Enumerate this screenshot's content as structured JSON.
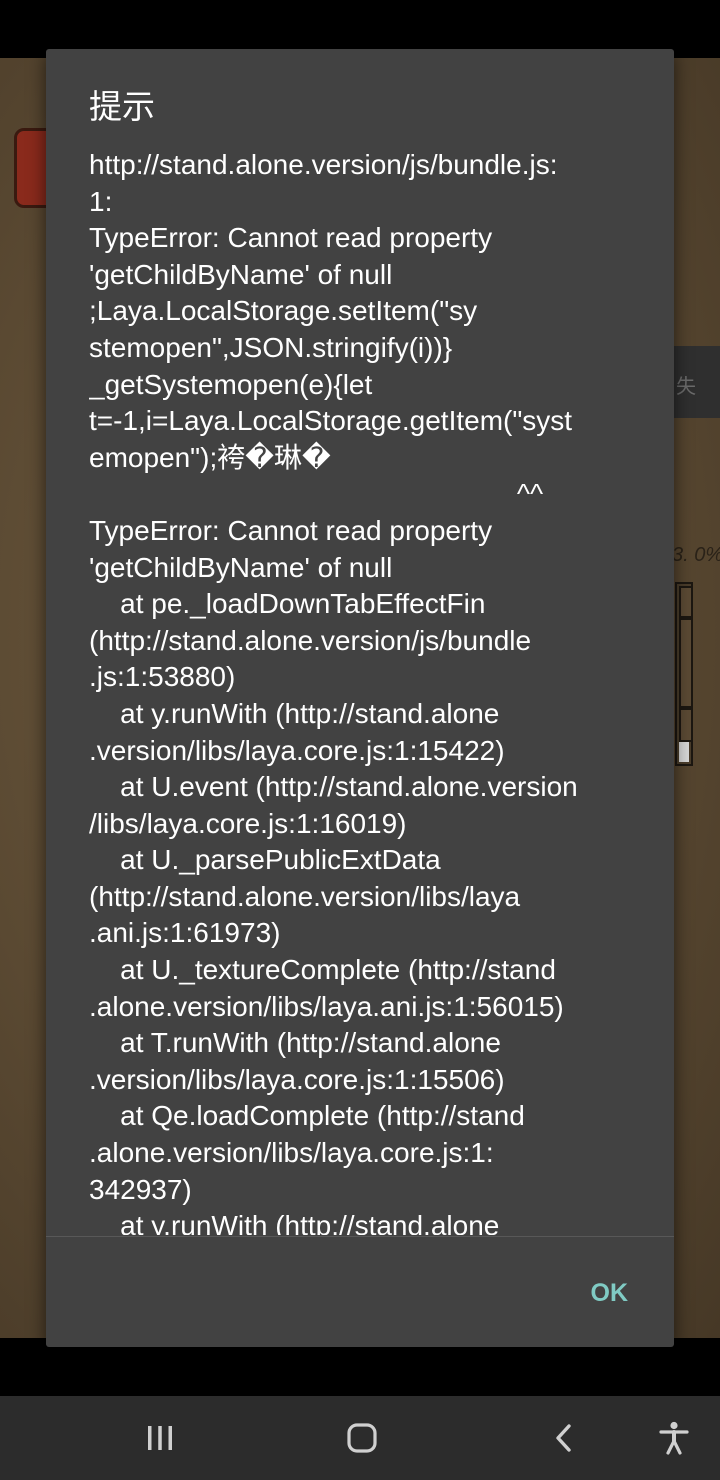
{
  "background_game": {
    "side_tab_text": "失",
    "progress_text": "3. 0%"
  },
  "dialog": {
    "title": "提示",
    "message": "http://stand.alone.version/js/bundle.js:\n1:\nTypeError: Cannot read property\n'getChildByName' of null\n;Laya.LocalStorage.setItem(\"sy\nstemopen\",JSON.stringify(i))}\n_getSystemopen(e){let\nt=-1,i=Laya.LocalStorage.getItem(\"syst\nemopen\");袴�琳�\n                                                       ^^\nTypeError: Cannot read property\n'getChildByName' of null\n    at pe._loadDownTabEffectFin\n(http://stand.alone.version/js/bundle\n.js:1:53880)\n    at y.runWith (http://stand.alone\n.version/libs/laya.core.js:1:15422)\n    at U.event (http://stand.alone.version\n/libs/laya.core.js:1:16019)\n    at U._parsePublicExtData\n(http://stand.alone.version/libs/laya\n.ani.js:1:61973)\n    at U._textureComplete (http://stand\n.alone.version/libs/laya.ani.js:1:56015)\n    at T.runWith (http://stand.alone\n.version/libs/laya.core.js:1:15506)\n    at Qe.loadComplete (http://stand\n.alone.version/libs/laya.core.js:1:\n342937)\n    at y.runWith (http://stand.alone",
    "ok_label": "OK"
  },
  "colors": {
    "dialog_bg": "#424242",
    "accent": "#80cbc4",
    "nav_bar_bg": "#2c2c2c",
    "nav_icon": "#d0d0d0"
  },
  "nav_bar": {
    "icons": [
      "recent-apps-icon",
      "home-icon",
      "back-icon",
      "accessibility-icon"
    ]
  }
}
